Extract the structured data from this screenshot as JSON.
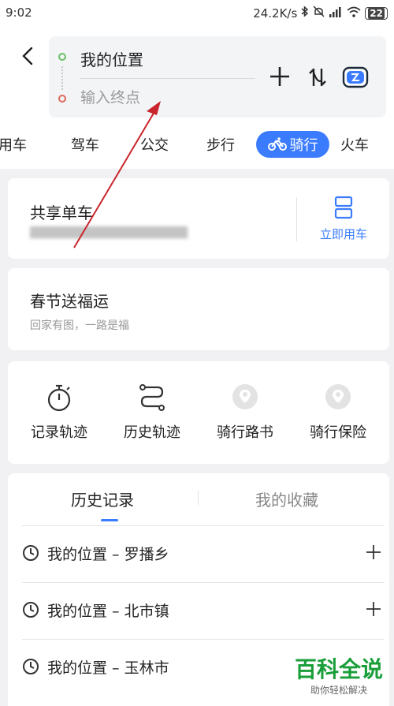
{
  "status_bar": {
    "time": "9:02",
    "net_speed": "24.2K/s",
    "battery": "22"
  },
  "route": {
    "start": "我的位置",
    "end_placeholder": "输入终点"
  },
  "modes": {
    "items": [
      "用车",
      "驾车",
      "公交",
      "步行",
      "骑行",
      "火车"
    ],
    "active": "骑行"
  },
  "bike_share": {
    "title": "共享单车",
    "action": "立即用车"
  },
  "promo": {
    "title": "春节送福运",
    "subtitle": "回家有图，一路是福"
  },
  "quick_actions": [
    {
      "label": "记录轨迹",
      "icon": "stopwatch-icon"
    },
    {
      "label": "历史轨迹",
      "icon": "route-icon"
    },
    {
      "label": "骑行路书",
      "icon": "map-pin-icon"
    },
    {
      "label": "骑行保险",
      "icon": "map-pin-icon"
    }
  ],
  "history": {
    "tabs": [
      "历史记录",
      "我的收藏"
    ],
    "active_tab": "历史记录",
    "items": [
      "我的位置 – 罗播乡",
      "我的位置 – 北市镇",
      "我的位置 – 玉林市"
    ]
  },
  "watermark": {
    "title": "百科全说",
    "subtitle": "助你轻松解决"
  },
  "colors": {
    "accent": "#3b7cff",
    "start_dot": "#6abf6a",
    "end_dot": "#e06a5e",
    "annotation_arrow": "#c9252c",
    "watermark": "#1a9e3a"
  }
}
